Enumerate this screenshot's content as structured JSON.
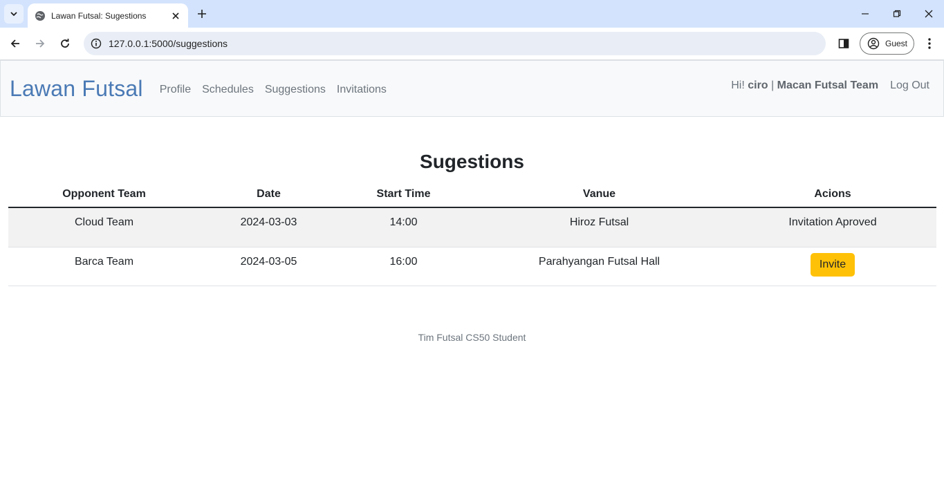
{
  "browser": {
    "tab_title": "Lawan Futsal: Sugestions",
    "url": "127.0.0.1:5000/suggestions",
    "profile_label": "Guest"
  },
  "navbar": {
    "brand": "Lawan Futsal",
    "links": [
      "Profile",
      "Schedules",
      "Suggestions",
      "Invitations"
    ],
    "greeting_prefix": "Hi!",
    "username": "ciro",
    "separator": "|",
    "team_name": "Macan Futsal Team",
    "logout": "Log Out"
  },
  "main": {
    "title": "Sugestions",
    "columns": [
      "Opponent Team",
      "Date",
      "Start Time",
      "Vanue",
      "Acions"
    ],
    "rows": [
      {
        "team": "Cloud Team",
        "date": "2024-03-03",
        "time": "14:00",
        "venue": "Hiroz Futsal",
        "action": "Invitation Aproved"
      },
      {
        "team": "Barca Team",
        "date": "2024-03-05",
        "time": "16:00",
        "venue": "Parahyangan Futsal Hall",
        "action": "Invite"
      }
    ]
  },
  "footer": {
    "text": "Tim Futsal CS50 Student"
  },
  "colors": {
    "brand": "#4a7ab5",
    "invite_button": "#ffc107",
    "tabstrip": "#d3e3fd"
  }
}
